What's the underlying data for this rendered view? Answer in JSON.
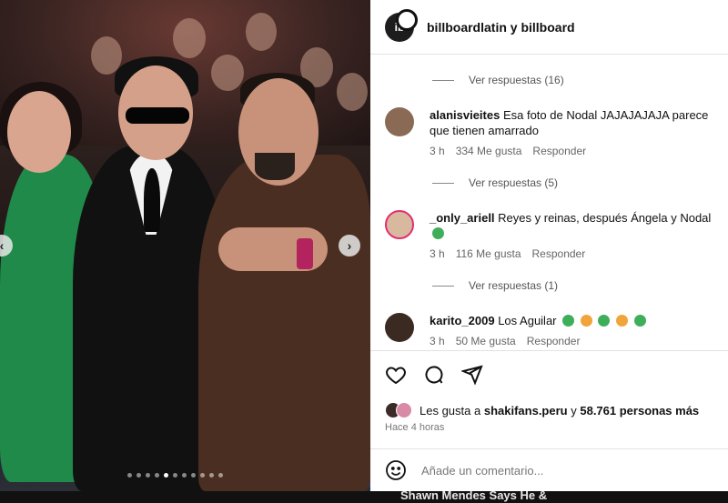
{
  "header": {
    "title": "billboardlatin y billboard",
    "avatar_text": "ib"
  },
  "photo": {
    "carousel_index": 5,
    "carousel_count": 11
  },
  "comments": [
    {
      "replies_label": "Ver respuestas (16)"
    },
    {
      "user": "alanisvieites",
      "text": "Esa foto de Nodal JAJAJAJAJA parece que tienen amarrado",
      "time": "3 h",
      "likes": "334 Me gusta",
      "reply": "Responder",
      "replies_label": "Ver respuestas (5)",
      "avatar_color": "#8a6a55"
    },
    {
      "user": "_only_ariell",
      "text": "Reyes y reinas, después Ángela y Nodal",
      "time": "3 h",
      "likes": "116 Me gusta",
      "reply": "Responder",
      "replies_label": "Ver respuestas (1)",
      "avatar_color": "#d9b8a0"
    },
    {
      "user": "karito_2009",
      "text": "Los Aguilar",
      "time": "3 h",
      "likes": "50 Me gusta",
      "reply": "Responder",
      "avatar_color": "#3a2a22"
    }
  ],
  "likes": {
    "prefix": "Les gusta a",
    "user": "shakifans.peru",
    "middle": "y",
    "count": "58.761 personas más"
  },
  "post_time": "Hace 4 horas",
  "add_comment": {
    "placeholder": "Añade un comentario..."
  },
  "ticker": "Shawn Mendes Says He &"
}
